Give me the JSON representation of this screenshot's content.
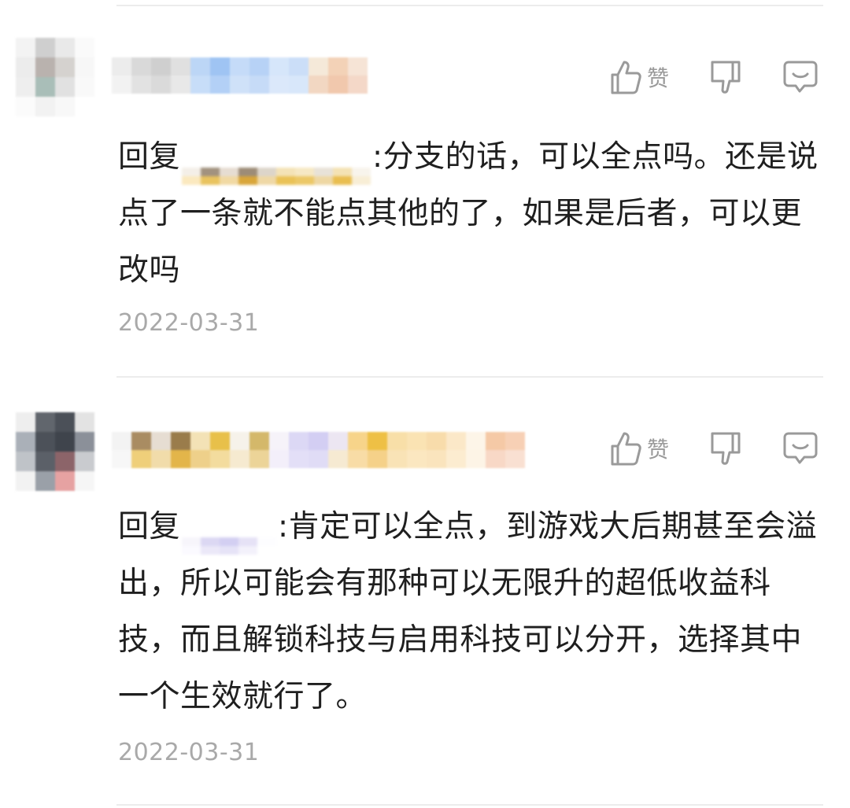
{
  "comments": [
    {
      "reply_prefix": "回复",
      "text_after_mention": ":分支的话，可以全点吗。还是说点了一条就不能点其他的了，如果是后者，可以更改吗",
      "date": "2022-03-31",
      "like_label": "赞"
    },
    {
      "reply_prefix": "回复",
      "text_after_mention": ":肯定可以全点，到游戏大后期甚至会溢出，所以可能会有那种可以无限升的超低收益科技，而且解锁科技与启用科技可以分开，选择其中一个生效就行了。",
      "date": "2022-03-31",
      "like_label": "赞"
    }
  ],
  "icons": {
    "like": "thumbs-up-icon",
    "dislike": "thumbs-down-icon",
    "reply": "comment-bubble-icon"
  },
  "colors": {
    "text": "#1f1f1f",
    "muted": "#a9a9a9",
    "icon": "#9a9a9a",
    "divider": "#ececec"
  }
}
